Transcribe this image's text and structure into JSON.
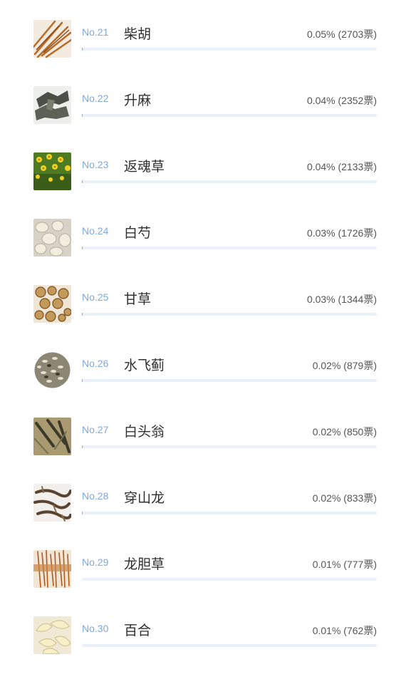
{
  "ranking": {
    "items": [
      {
        "rank": "No.21",
        "name": "柴胡",
        "percent_text": "0.05% (2703票)",
        "percent": 0.05,
        "votes": 2703,
        "image": "chaihu-image"
      },
      {
        "rank": "No.22",
        "name": "升麻",
        "percent_text": "0.04% (2352票)",
        "percent": 0.04,
        "votes": 2352,
        "image": "shengma-image"
      },
      {
        "rank": "No.23",
        "name": "返魂草",
        "percent_text": "0.04% (2133票)",
        "percent": 0.04,
        "votes": 2133,
        "image": "fanhuncao-image"
      },
      {
        "rank": "No.24",
        "name": "白芍",
        "percent_text": "0.03% (1726票)",
        "percent": 0.03,
        "votes": 1726,
        "image": "baishao-image"
      },
      {
        "rank": "No.25",
        "name": "甘草",
        "percent_text": "0.03% (1344票)",
        "percent": 0.03,
        "votes": 1344,
        "image": "gancao-image"
      },
      {
        "rank": "No.26",
        "name": "水飞蓟",
        "percent_text": "0.02% (879票)",
        "percent": 0.02,
        "votes": 879,
        "image": "shuifeiji-image"
      },
      {
        "rank": "No.27",
        "name": "白头翁",
        "percent_text": "0.02% (850票)",
        "percent": 0.02,
        "votes": 850,
        "image": "baitouweng-image"
      },
      {
        "rank": "No.28",
        "name": "穿山龙",
        "percent_text": "0.02% (833票)",
        "percent": 0.02,
        "votes": 833,
        "image": "chuanshanlong-image"
      },
      {
        "rank": "No.29",
        "name": "龙胆草",
        "percent_text": "0.01% (777票)",
        "percent": 0.01,
        "votes": 777,
        "image": "longdancao-image"
      },
      {
        "rank": "No.30",
        "name": "百合",
        "percent_text": "0.01% (762票)",
        "percent": 0.01,
        "votes": 762,
        "image": "baihe-image"
      }
    ]
  },
  "colors": {
    "rank": "#7fa8dc",
    "bar_track": "#eaf1fb",
    "bar_fill": "#7fa8dc",
    "name": "#2e2e2e",
    "stat": "#555555"
  }
}
